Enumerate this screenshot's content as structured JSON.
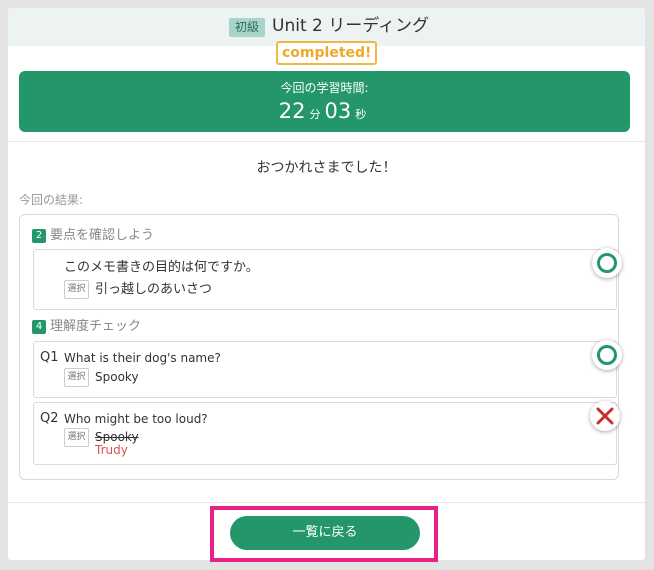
{
  "header": {
    "level_badge": "初級",
    "unit_title": "Unit 2 リーディング",
    "completed": "completed!"
  },
  "timer": {
    "label": "今回の学習時間:",
    "minutes": "22",
    "minutes_unit": "分",
    "seconds": "03",
    "seconds_unit": "秒"
  },
  "thanks_message": "おつかれさまでした！",
  "result_label": "今回の結果:",
  "sections": [
    {
      "number": "2",
      "title": "要点を確認しよう",
      "items": [
        {
          "question": "このメモ書きの目的は何ですか。",
          "select_tag": "選択",
          "answer": "引っ越しのあいさつ",
          "result": "correct",
          "result_icon": "circle-correct-icon"
        }
      ]
    },
    {
      "number": "4",
      "title": "理解度チェック",
      "items": [
        {
          "qnum": "Q1",
          "question": "What is their dog's name?",
          "select_tag": "選択",
          "answer": "Spooky",
          "result": "correct",
          "result_icon": "circle-correct-icon"
        },
        {
          "qnum": "Q2",
          "question": "Who might be too loud?",
          "select_tag": "選択",
          "answer": "Spooky",
          "correct_answer": "Trudy",
          "result": "incorrect",
          "result_icon": "cross-incorrect-icon"
        }
      ]
    }
  ],
  "back_button": "一覧に戻る",
  "colors": {
    "accent": "#24976a",
    "completed": "#f0a82a",
    "incorrect": "#d9534f",
    "highlight": "#e8208a"
  }
}
